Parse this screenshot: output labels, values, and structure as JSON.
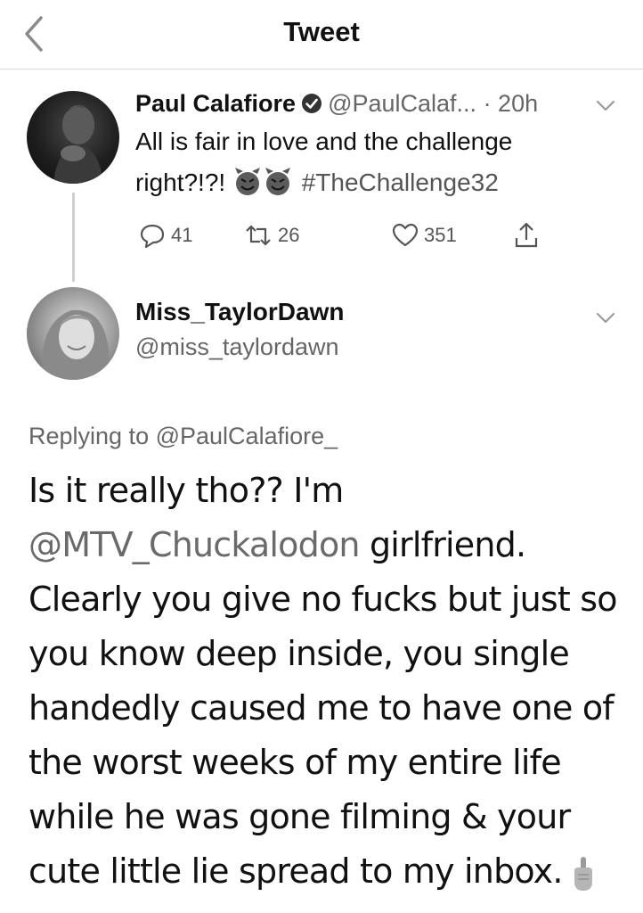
{
  "header": {
    "title": "Tweet",
    "back_icon": "chevron-left-icon"
  },
  "tweet1": {
    "name": "Paul Calafiore",
    "verified_icon": "verified-badge-icon",
    "handle": "@PaulCalaf...",
    "time": "· 20h",
    "text_line1": "All is fair in love and the challenge",
    "text_line2": "right?!?!",
    "emoji": "smiling-devil-emoji",
    "hashtag": "#TheChallenge32",
    "replies": "41",
    "retweets": "26",
    "likes": "351"
  },
  "tweet2": {
    "name": "Miss_TaylorDawn",
    "handle": "@miss_taylordawn",
    "replying_prefix": "Replying to",
    "replying_to": "@PaulCalafiore_",
    "line1": "Is it really tho?? I'm",
    "mention": "@MTV_Chuckalodon",
    "line2_rest": " girlfriend.",
    "line3": "Clearly you give no fucks but just so",
    "line4": "you know deep inside, you single",
    "line5": "handedly caused me to have one of",
    "line6": "the worst weeks of my entire life",
    "line7": "while he was gone filming & your",
    "line8": "cute little lie spread to my inbox.",
    "end_emoji": "middle-finger-emoji"
  },
  "colors": {
    "text": "#111111",
    "secondary": "#666666",
    "divider": "#d9d9d9"
  }
}
